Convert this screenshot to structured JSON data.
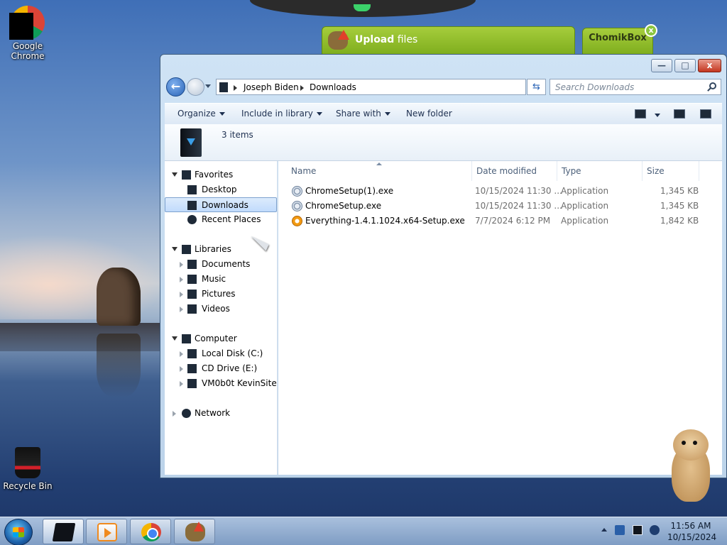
{
  "desktop": {
    "icons": [
      {
        "label": "Google\nChrome",
        "label_line1": "Google",
        "label_line2": "Chrome"
      },
      {
        "label": "Recycle Bin"
      }
    ]
  },
  "widgets": {
    "upload_bold": "Upload",
    "upload_rest": " files",
    "chomikbox": "ChomikBox",
    "close_glyph": "x"
  },
  "window": {
    "title_buttons": {
      "min": "—",
      "max": "□",
      "close": "x"
    },
    "address": {
      "crumbs": [
        "Joseph Biden",
        "Downloads"
      ]
    },
    "search_placeholder": "Search Downloads",
    "commands": [
      {
        "label": "Organize",
        "dropdown": true
      },
      {
        "label": "Include in library",
        "dropdown": true
      },
      {
        "label": "Share with",
        "dropdown": true
      },
      {
        "label": "New folder",
        "dropdown": false
      }
    ],
    "item_count": "3 items",
    "nav": {
      "favorites": "Favorites",
      "desktop": "Desktop",
      "downloads": "Downloads",
      "recent": "Recent Places",
      "libraries": "Libraries",
      "documents": "Documents",
      "music": "Music",
      "pictures": "Pictures",
      "videos": "Videos",
      "computer": "Computer",
      "local_disk": "Local Disk (C:)",
      "cd_drive": "CD Drive (E:)",
      "vm": "VM0b0t KevinSite",
      "network": "Network"
    },
    "columns": {
      "name": "Name",
      "date": "Date modified",
      "type": "Type",
      "size": "Size"
    },
    "files": [
      {
        "name": "ChromeSetup(1).exe",
        "date": "10/15/2024 11:30 ...",
        "type": "Application",
        "size": "1,345 KB",
        "icon": "installer-icon"
      },
      {
        "name": "ChromeSetup.exe",
        "date": "10/15/2024 11:30 ...",
        "type": "Application",
        "size": "1,345 KB",
        "icon": "installer-icon"
      },
      {
        "name": "Everything-1.4.1.1024.x64-Setup.exe",
        "date": "7/7/2024 6:12 PM",
        "type": "Application",
        "size": "1,842 KB",
        "icon": "magnifier-icon"
      }
    ]
  },
  "taskbar": {
    "clock_time": "11:56 AM",
    "clock_date": "10/15/2024"
  }
}
